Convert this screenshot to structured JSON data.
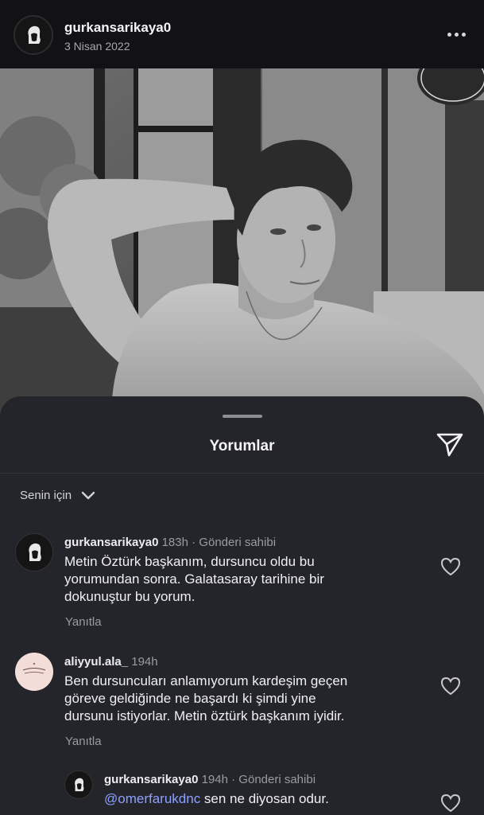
{
  "post": {
    "username": "gurkansarikaya0",
    "date": "3 Nisan 2022",
    "more_icon": "more-horizontal-icon"
  },
  "comments_sheet": {
    "title": "Yorumlar",
    "share_icon": "send-icon",
    "filter_label": "Senin için",
    "filter_icon": "chevron-down-icon",
    "comments": [
      {
        "username": "gurkansarikaya0",
        "time": "183h",
        "badge": "· Gönderi sahibi",
        "text_lines": [
          "Metin Öztürk başkanım, dursuncu oldu bu",
          "yorumundan sonra. Galatasaray tarihine bir",
          "dokunuştur bu yorum."
        ],
        "reply_label": "Yanıtla"
      },
      {
        "username": "aliyyul.ala_",
        "time": "194h",
        "badge": "",
        "text_lines": [
          "Ben dursuncuları anlamıyorum kardeşim geçen",
          "göreve geldiğinde ne başardı ki şimdi yine",
          "dursunu istiyorlar. Metin öztürk başkanım iyidir."
        ],
        "reply_label": "Yanıtla"
      },
      {
        "username": "gurkansarikaya0",
        "time": "194h",
        "badge": "· Gönderi sahibi",
        "mention": "@omerfarukdnc",
        "text": " sen ne diyosan odur."
      }
    ]
  },
  "colors": {
    "sheet_bg": "#24252b",
    "header_bg": "#121214",
    "mention": "#8ea0ff",
    "muted": "#9a9aa1"
  }
}
